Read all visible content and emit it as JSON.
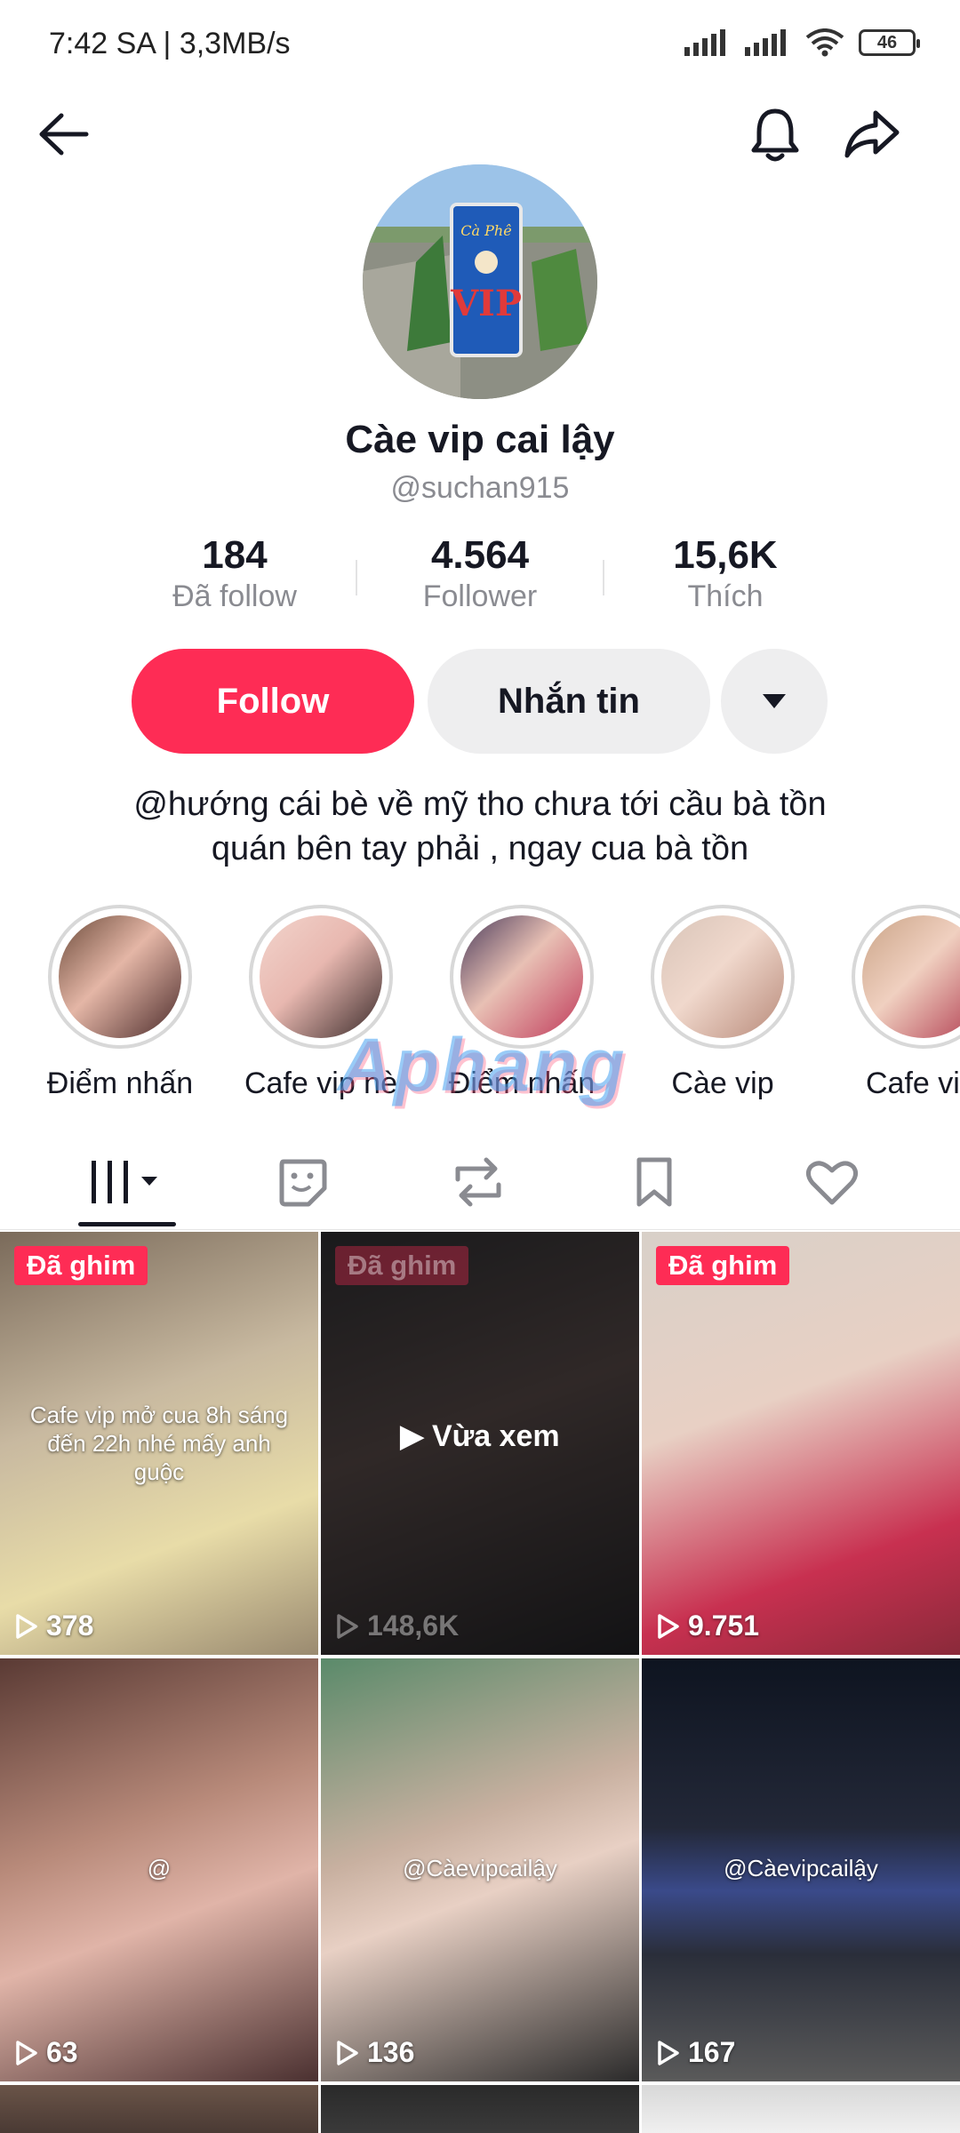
{
  "status": {
    "time": "7:42 SA | 3,3MB/s",
    "battery": "46"
  },
  "profile": {
    "name": "Càe vip cai lậy",
    "handle": "@suchan915",
    "stats": [
      {
        "value": "184",
        "label": "Đã follow"
      },
      {
        "value": "4.564",
        "label": "Follower"
      },
      {
        "value": "15,6K",
        "label": "Thích"
      }
    ],
    "buttons": {
      "follow": "Follow",
      "message": "Nhắn tin"
    },
    "bio_line1": "@hướng cái bè về mỹ tho chưa tới cầu bà tồn",
    "bio_line2": "quán bên tay phải , ngay cua bà tồn",
    "avatar_sign_text": "Cà Phê VIP"
  },
  "highlights": [
    {
      "label": "Điểm nhấn"
    },
    {
      "label": "Cafe vip nè"
    },
    {
      "label": "Điểm nhấn"
    },
    {
      "label": "Càe vip"
    },
    {
      "label": "Cafe vi"
    }
  ],
  "watermark": "Aphang",
  "tabs": [
    "videos",
    "stickers",
    "reposts",
    "favorites",
    "liked"
  ],
  "videos": [
    {
      "pinned": "Đã ghim",
      "views": "378",
      "caption": "Cafe vip mở cua 8h sáng đến 22h nhé mấy anh guộc"
    },
    {
      "pinned": "Đã ghim",
      "views": "148,6K",
      "watched": "Vừa xem"
    },
    {
      "pinned": "Đã ghim",
      "views": "9.751"
    },
    {
      "views": "63",
      "caption": "@"
    },
    {
      "views": "136",
      "caption": "@Càevipcailậy"
    },
    {
      "views": "167",
      "caption": "@Càevipcailậy"
    }
  ],
  "colors": {
    "accent": "#fe2c55",
    "text": "#161823",
    "muted": "#8a8b91"
  }
}
